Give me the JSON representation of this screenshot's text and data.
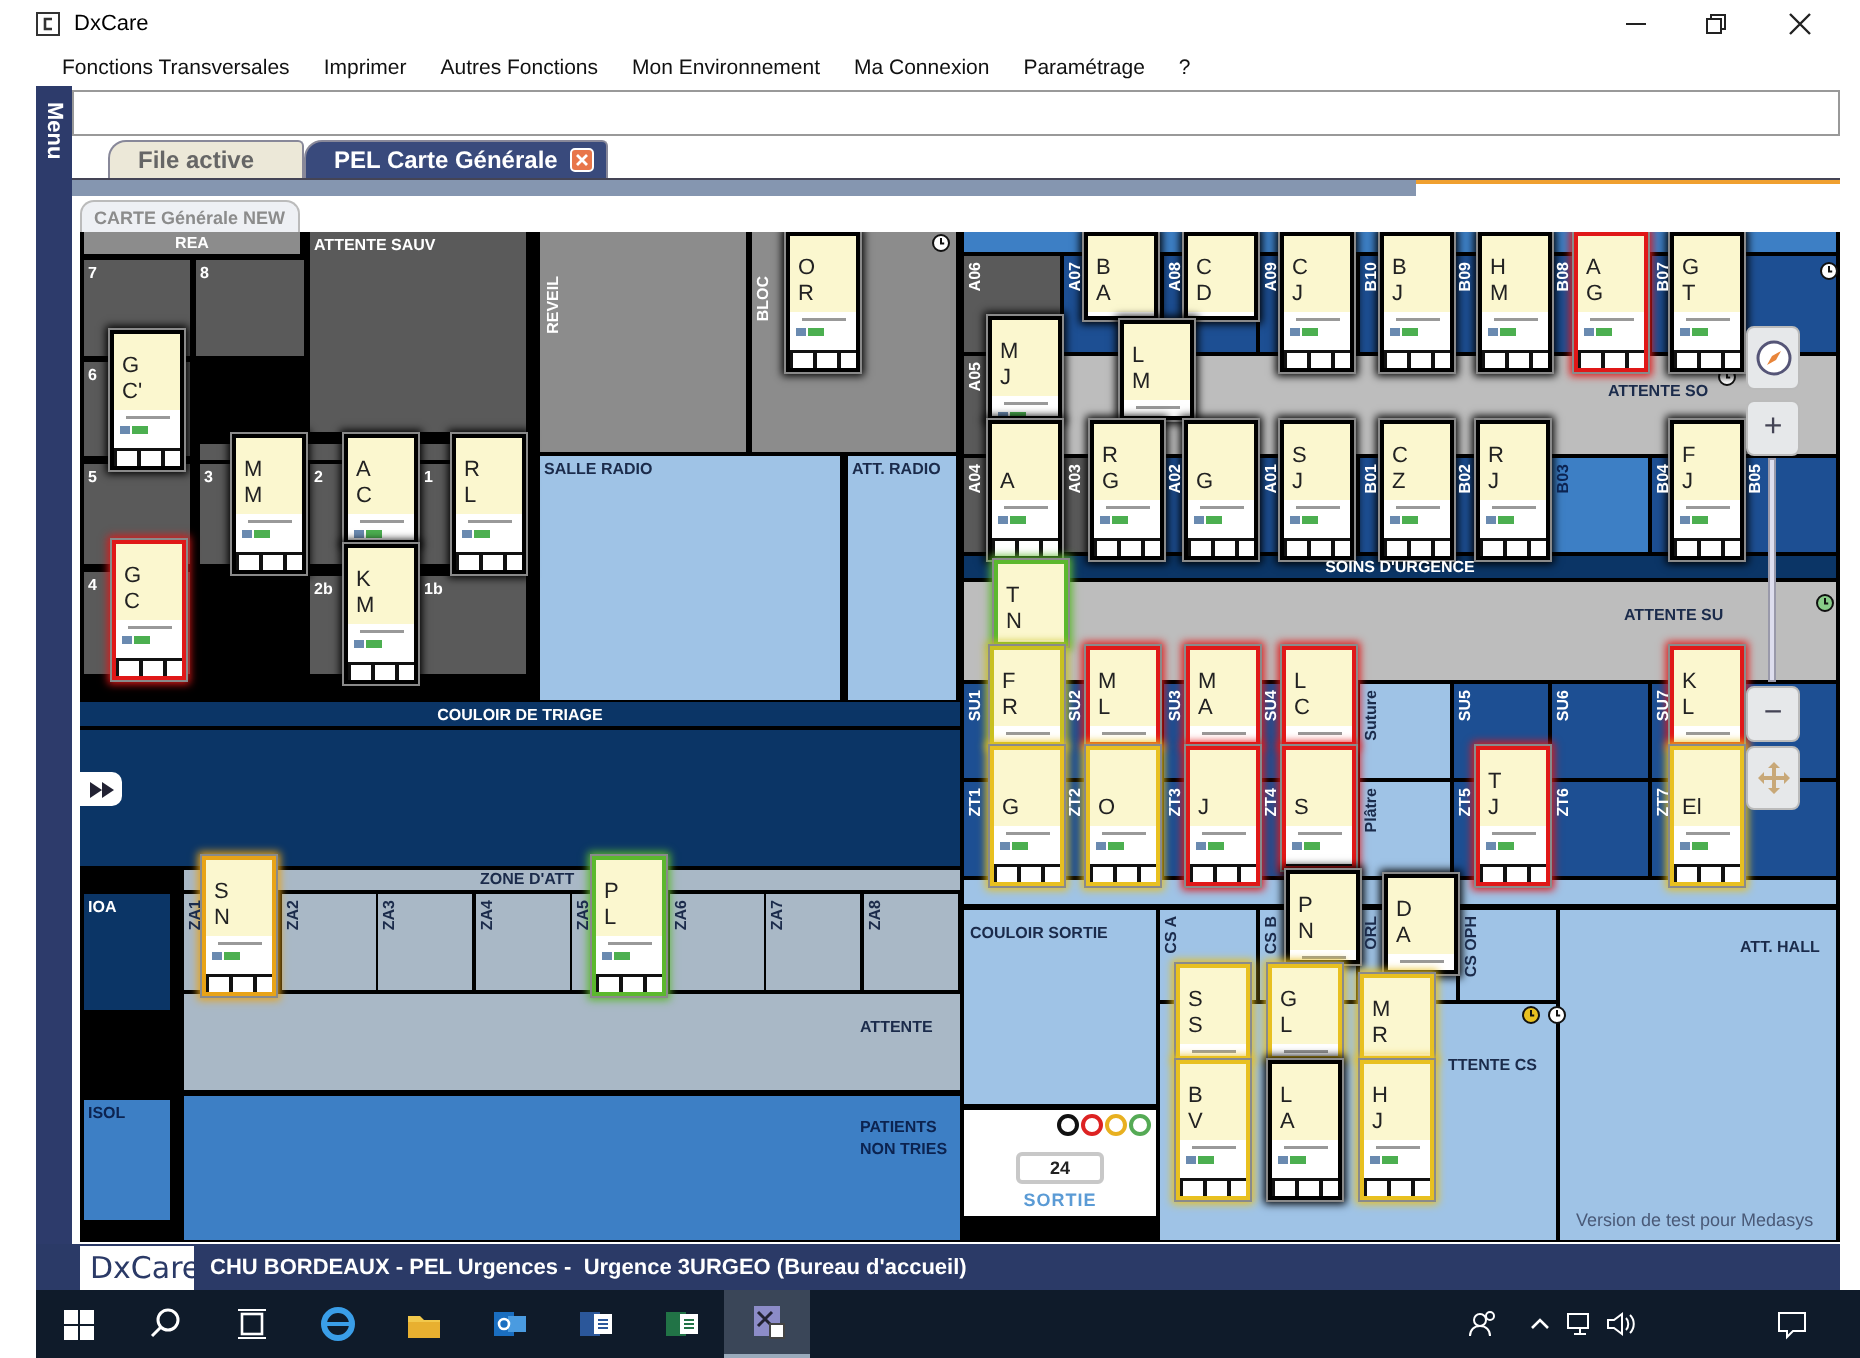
{
  "window": {
    "title": "DxCare"
  },
  "menu": [
    "Fonctions Transversales",
    "Imprimer",
    "Autres Fonctions",
    "Mon Environnement",
    "Ma Connexion",
    "Paramétrage",
    "?"
  ],
  "side_menu": {
    "label": "Menu"
  },
  "tabs": [
    {
      "label": "File active",
      "selected": false
    },
    {
      "label": "PEL Carte Générale",
      "selected": true
    }
  ],
  "view_tab": {
    "label": "CARTE Générale NEW"
  },
  "map": {
    "rooms": [
      {
        "label": "REA",
        "kind": "grey"
      },
      {
        "label": "7",
        "kind": "dark"
      },
      {
        "label": "8",
        "kind": "dark"
      },
      {
        "label": "ATTENTE SAUV",
        "kind": "dark"
      },
      {
        "label": "REVEIL",
        "kind": "grey"
      },
      {
        "label": "BLOC",
        "kind": "grey"
      },
      {
        "label": "6",
        "kind": "dark"
      },
      {
        "label": "5",
        "kind": "dark"
      },
      {
        "label": "3",
        "kind": "dark"
      },
      {
        "label": "2",
        "kind": "dark"
      },
      {
        "label": "1",
        "kind": "dark"
      },
      {
        "label": "4",
        "kind": "dark"
      },
      {
        "label": "2b",
        "kind": "dark"
      },
      {
        "label": "1b",
        "kind": "dark"
      },
      {
        "kind": "dark"
      },
      {
        "label": "SALLE RADIO",
        "kind": "light"
      },
      {
        "label": "ATT. RADIO",
        "kind": "light"
      },
      {
        "label": "COULOIR DE TRIAGE",
        "kind": "navy"
      },
      {
        "kind": "navy"
      },
      {
        "label": "ZONE D'ATT",
        "kind": "greyblue"
      },
      {
        "label": "ZA1",
        "kind": "greyblue"
      },
      {
        "label": "ZA2",
        "kind": "greyblue"
      },
      {
        "label": "ZA3",
        "kind": "greyblue"
      },
      {
        "label": "ZA4",
        "kind": "greyblue"
      },
      {
        "label": "ZA5",
        "kind": "greyblue"
      },
      {
        "label": "ZA6",
        "kind": "greyblue"
      },
      {
        "label": "ZA7",
        "kind": "greyblue"
      },
      {
        "label": "ZA8",
        "kind": "greyblue"
      },
      {
        "label": "IOA",
        "kind": "navy"
      },
      {
        "label": "ATTENTE",
        "kind": "greyblue"
      },
      {
        "label": "ISOL",
        "kind": "blue"
      },
      {
        "label": "PATIENTS NON TRIES",
        "kind": "blue"
      },
      {
        "kind": "blue"
      },
      {
        "label": "A06",
        "kind": "dark"
      },
      {
        "label": "A07",
        "kind": "cell"
      },
      {
        "label": "A08",
        "kind": "cell"
      },
      {
        "label": "A09",
        "kind": "cell"
      },
      {
        "label": "B10",
        "kind": "cell"
      },
      {
        "label": "B09",
        "kind": "cell"
      },
      {
        "label": "B08",
        "kind": "cell"
      },
      {
        "label": "B07",
        "kind": "cell"
      },
      {
        "label": "A05",
        "kind": "dark"
      },
      {
        "label": "ATTENTE SO",
        "kind": "lightgrey"
      },
      {
        "label": "A04",
        "kind": "dark"
      },
      {
        "label": "A03",
        "kind": "dark"
      },
      {
        "label": "A02",
        "kind": "cell"
      },
      {
        "label": "A01",
        "kind": "cell"
      },
      {
        "label": "B01",
        "kind": "cell"
      },
      {
        "label": "B02",
        "kind": "cell"
      },
      {
        "label": "B03",
        "kind": "blue"
      },
      {
        "label": "B04",
        "kind": "cell"
      },
      {
        "label": "B05",
        "kind": "cell"
      },
      {
        "label": "SOINS D'URGENCE",
        "kind": "navy"
      },
      {
        "label": "ATTENTE SU",
        "kind": "lightgrey"
      },
      {
        "label": "SU1",
        "kind": "cell"
      },
      {
        "label": "SU2",
        "kind": "cell"
      },
      {
        "label": "SU3",
        "kind": "cell"
      },
      {
        "label": "SU4",
        "kind": "cell"
      },
      {
        "label": "Suture",
        "kind": "light"
      },
      {
        "label": "SU5",
        "kind": "cell"
      },
      {
        "label": "SU6",
        "kind": "cell"
      },
      {
        "label": "SU7",
        "kind": "cell"
      },
      {
        "kind": "cell"
      },
      {
        "label": "ZT1",
        "kind": "cell"
      },
      {
        "label": "ZT2",
        "kind": "cell"
      },
      {
        "label": "ZT3",
        "kind": "cell"
      },
      {
        "label": "ZT4",
        "kind": "cell"
      },
      {
        "label": "Plâtre",
        "kind": "light"
      },
      {
        "label": "ZT5",
        "kind": "cell"
      },
      {
        "label": "ZT6",
        "kind": "cell"
      },
      {
        "label": "ZT7",
        "kind": "cell"
      },
      {
        "kind": "cell"
      },
      {
        "kind": "light"
      },
      {
        "label": "COULOIR SORTIE",
        "kind": "light"
      },
      {
        "label": "CS A",
        "kind": "light"
      },
      {
        "label": "CS B",
        "kind": "light"
      },
      {
        "label": "ORL",
        "kind": "light"
      },
      {
        "label": "CS OPH",
        "kind": "light"
      },
      {
        "label": "TTENTE CS",
        "kind": "light"
      },
      {
        "label": "ATT. HALL",
        "kind": "light"
      },
      {
        "label": "SORTIE",
        "kind": "white",
        "count": "24"
      }
    ],
    "cards": [
      {
        "lines": [
          "O",
          "R"
        ],
        "color": "#000000"
      },
      {
        "lines": [
          "G",
          "C'"
        ],
        "color": "#000000"
      },
      {
        "lines": [
          "M",
          "M"
        ],
        "color": "#000000"
      },
      {
        "lines": [
          "A",
          "C"
        ],
        "color": "#000000"
      },
      {
        "lines": [
          "R",
          "L"
        ],
        "color": "#000000"
      },
      {
        "lines": [
          "G",
          "C"
        ],
        "color": "#e01818"
      },
      {
        "lines": [
          "K",
          "M"
        ],
        "color": "#000000"
      },
      {
        "lines": [
          "S",
          "N"
        ],
        "color": "#e8a317"
      },
      {
        "lines": [
          "P",
          "L"
        ],
        "color": "#5cb82e"
      },
      {
        "lines": [
          "B",
          "A"
        ],
        "color": "#000000"
      },
      {
        "lines": [
          "C",
          "D"
        ],
        "color": "#000000"
      },
      {
        "lines": [
          "C",
          "J"
        ],
        "color": "#000000"
      },
      {
        "lines": [
          "B",
          "J"
        ],
        "color": "#000000"
      },
      {
        "lines": [
          "H",
          "M"
        ],
        "color": "#000000"
      },
      {
        "lines": [
          "A",
          "G"
        ],
        "color": "#e01818"
      },
      {
        "lines": [
          "G",
          "T"
        ],
        "color": "#000000"
      },
      {
        "lines": [
          "M",
          "J"
        ],
        "color": "#000000"
      },
      {
        "lines": [
          "L",
          "M"
        ],
        "color": "#000000"
      },
      {
        "lines": [
          "A"
        ],
        "color": "#000000"
      },
      {
        "lines": [
          "R",
          "G"
        ],
        "color": "#000000"
      },
      {
        "lines": [
          "G"
        ],
        "color": "#000000"
      },
      {
        "lines": [
          "S",
          "J"
        ],
        "color": "#000000"
      },
      {
        "lines": [
          "C",
          "Z"
        ],
        "color": "#000000"
      },
      {
        "lines": [
          "R",
          "J"
        ],
        "color": "#000000"
      },
      {
        "lines": [
          "F",
          "J"
        ],
        "color": "#000000"
      },
      {
        "lines": [
          "T",
          "N"
        ],
        "color": "#5cb82e"
      },
      {
        "lines": [
          "F",
          "R"
        ],
        "color": "#c8c020"
      },
      {
        "lines": [
          "M",
          "L"
        ],
        "color": "#e01818"
      },
      {
        "lines": [
          "M",
          "A"
        ],
        "color": "#e01818"
      },
      {
        "lines": [
          "L",
          "C"
        ],
        "color": "#e01818"
      },
      {
        "lines": [
          "K",
          "L"
        ],
        "color": "#e01818"
      },
      {
        "lines": [
          "G"
        ],
        "color": "#e8c020"
      },
      {
        "lines": [
          "O"
        ],
        "color": "#e8c020"
      },
      {
        "lines": [
          "J"
        ],
        "color": "#e01818"
      },
      {
        "lines": [
          "S"
        ],
        "color": "#e01818"
      },
      {
        "lines": [
          "T",
          "J"
        ],
        "color": "#e01818"
      },
      {
        "lines": [
          "El"
        ],
        "color": "#e8c020"
      },
      {
        "lines": [
          "P",
          "N"
        ],
        "color": "#000000"
      },
      {
        "lines": [
          "D",
          "A"
        ],
        "color": "#000000"
      },
      {
        "lines": [
          "S",
          "S"
        ],
        "color": "#e8c020"
      },
      {
        "lines": [
          "G",
          "L"
        ],
        "color": "#e8c020"
      },
      {
        "lines": [
          "M",
          "R"
        ],
        "color": "#e8c020"
      },
      {
        "lines": [
          "B",
          "V"
        ],
        "color": "#e8c020"
      },
      {
        "lines": [
          "L",
          "A"
        ],
        "color": "#000000"
      },
      {
        "lines": [
          "H",
          "J"
        ],
        "color": "#e8c020"
      }
    ],
    "zoom_controls": {
      "zoom_in": "+",
      "zoom_out": "−"
    },
    "version_note": "Version de test pour Medasys"
  },
  "status_bar": {
    "logo": "DxCare",
    "text": "CHU BORDEAUX - PEL Urgences -  Urgence 3URGEO (Bureau d'accueil)"
  },
  "taskbar": {
    "apps": [
      {
        "kind": "start",
        "active": false
      },
      {
        "kind": "search",
        "active": false
      },
      {
        "kind": "taskview",
        "active": false
      },
      {
        "kind": "browser",
        "active": false
      },
      {
        "kind": "folder",
        "active": false
      },
      {
        "kind": "mail",
        "active": false
      },
      {
        "kind": "word",
        "active": false
      },
      {
        "kind": "sheet",
        "active": false
      },
      {
        "kind": "dxcare",
        "active": true
      }
    ]
  }
}
